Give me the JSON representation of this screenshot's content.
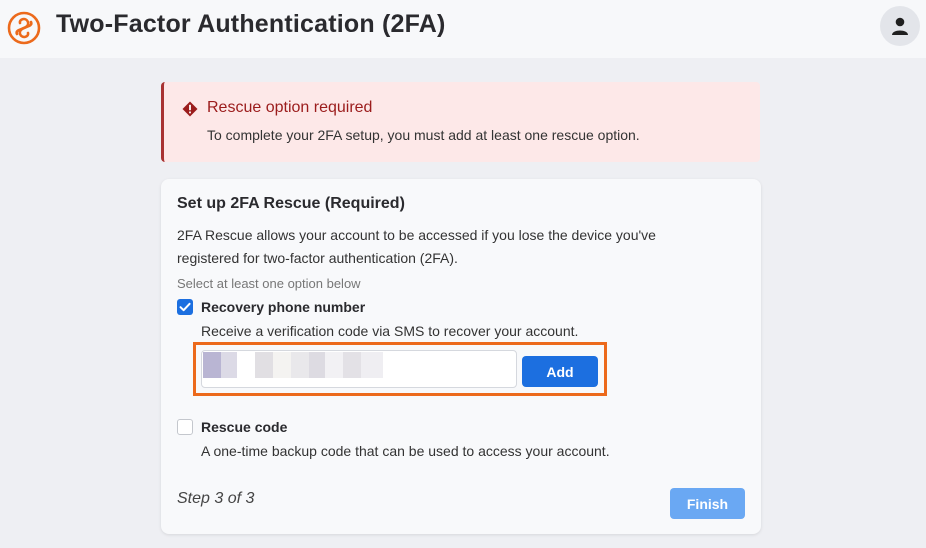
{
  "header": {
    "title": "Two-Factor Authentication (2FA)",
    "logo_icon": "swirl-logo-icon",
    "profile_icon": "user-icon"
  },
  "alert": {
    "title": "Rescue option required",
    "message": "To complete your 2FA setup, you must add at least one rescue option.",
    "icon": "warning-diamond-icon",
    "color": "#9b1c1c",
    "background": "#fde8e8"
  },
  "setup": {
    "title": "Set up 2FA Rescue (Required)",
    "description": "2FA Rescue allows your account to be accessed if you lose the device you've registered for two-factor authentication (2FA).",
    "hint": "Select at least one option below",
    "options": [
      {
        "label": "Recovery phone number",
        "description": "Receive a verification code via SMS to recover your account.",
        "checked": true
      },
      {
        "label": "Rescue code",
        "description": "A one-time backup code that can be used to access your account.",
        "checked": false
      }
    ],
    "phone_input": {
      "value": "",
      "placeholder": ""
    },
    "add_label": "Add",
    "step_text": "Step 3 of 3",
    "finish_label": "Finish"
  },
  "colors": {
    "accent": "#1c6fe0",
    "highlight": "#ec6a1c",
    "finish_disabled": "#6aa8f3"
  }
}
